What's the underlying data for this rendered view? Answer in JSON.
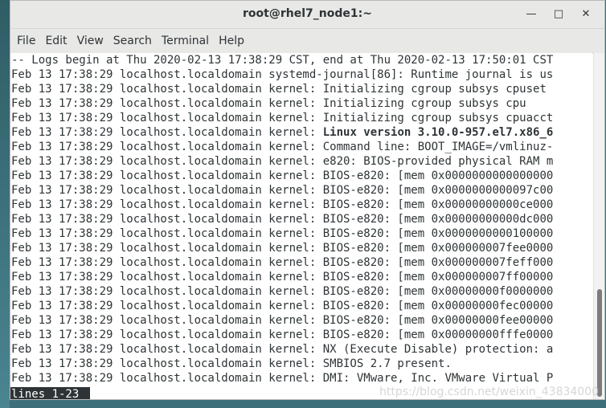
{
  "window": {
    "title": "root@rhel7_node1:~",
    "buttons": {
      "minimize": "—",
      "maximize": "□",
      "close": "✕"
    }
  },
  "menubar": [
    "File",
    "Edit",
    "View",
    "Search",
    "Terminal",
    "Help"
  ],
  "terminal": {
    "lines": [
      {
        "prefix": "-- Logs begin at Thu 2020-02-13 17:38:29 CST, end at Thu 2020-02-13 17:50:01 CST",
        "bold": ""
      },
      {
        "prefix": "Feb 13 17:38:29 localhost.localdomain systemd-journal[86]: Runtime journal is us",
        "bold": ""
      },
      {
        "prefix": "Feb 13 17:38:29 localhost.localdomain kernel: Initializing cgroup subsys cpuset",
        "bold": ""
      },
      {
        "prefix": "Feb 13 17:38:29 localhost.localdomain kernel: Initializing cgroup subsys cpu",
        "bold": ""
      },
      {
        "prefix": "Feb 13 17:38:29 localhost.localdomain kernel: Initializing cgroup subsys cpuacct",
        "bold": ""
      },
      {
        "prefix": "Feb 13 17:38:29 localhost.localdomain kernel: ",
        "bold": "Linux version 3.10.0-957.el7.x86_6"
      },
      {
        "prefix": "Feb 13 17:38:29 localhost.localdomain kernel: Command line: BOOT_IMAGE=/vmlinuz-",
        "bold": ""
      },
      {
        "prefix": "Feb 13 17:38:29 localhost.localdomain kernel: e820: BIOS-provided physical RAM m",
        "bold": ""
      },
      {
        "prefix": "Feb 13 17:38:29 localhost.localdomain kernel: BIOS-e820: [mem 0x0000000000000000",
        "bold": ""
      },
      {
        "prefix": "Feb 13 17:38:29 localhost.localdomain kernel: BIOS-e820: [mem 0x0000000000097c00",
        "bold": ""
      },
      {
        "prefix": "Feb 13 17:38:29 localhost.localdomain kernel: BIOS-e820: [mem 0x00000000000ce000",
        "bold": ""
      },
      {
        "prefix": "Feb 13 17:38:29 localhost.localdomain kernel: BIOS-e820: [mem 0x00000000000dc000",
        "bold": ""
      },
      {
        "prefix": "Feb 13 17:38:29 localhost.localdomain kernel: BIOS-e820: [mem 0x0000000000100000",
        "bold": ""
      },
      {
        "prefix": "Feb 13 17:38:29 localhost.localdomain kernel: BIOS-e820: [mem 0x000000007fee0000",
        "bold": ""
      },
      {
        "prefix": "Feb 13 17:38:29 localhost.localdomain kernel: BIOS-e820: [mem 0x000000007feff000",
        "bold": ""
      },
      {
        "prefix": "Feb 13 17:38:29 localhost.localdomain kernel: BIOS-e820: [mem 0x000000007ff00000",
        "bold": ""
      },
      {
        "prefix": "Feb 13 17:38:29 localhost.localdomain kernel: BIOS-e820: [mem 0x00000000f0000000",
        "bold": ""
      },
      {
        "prefix": "Feb 13 17:38:29 localhost.localdomain kernel: BIOS-e820: [mem 0x00000000fec00000",
        "bold": ""
      },
      {
        "prefix": "Feb 13 17:38:29 localhost.localdomain kernel: BIOS-e820: [mem 0x00000000fee00000",
        "bold": ""
      },
      {
        "prefix": "Feb 13 17:38:29 localhost.localdomain kernel: BIOS-e820: [mem 0x00000000fffe0000",
        "bold": ""
      },
      {
        "prefix": "Feb 13 17:38:29 localhost.localdomain kernel: NX (Execute Disable) protection: a",
        "bold": ""
      },
      {
        "prefix": "Feb 13 17:38:29 localhost.localdomain kernel: SMBIOS 2.7 present.",
        "bold": ""
      },
      {
        "prefix": "Feb 13 17:38:29 localhost.localdomain kernel: DMI: VMware, Inc. VMware Virtual P",
        "bold": ""
      }
    ],
    "status": "lines 1-23"
  },
  "watermark": "https://blog.csdn.net/weixin_43834000",
  "colors": {
    "terminal_bg": "#ffffff",
    "text": "#2e3436",
    "titlebar": "#e8e8e7",
    "status_bg": "#2e3436"
  }
}
